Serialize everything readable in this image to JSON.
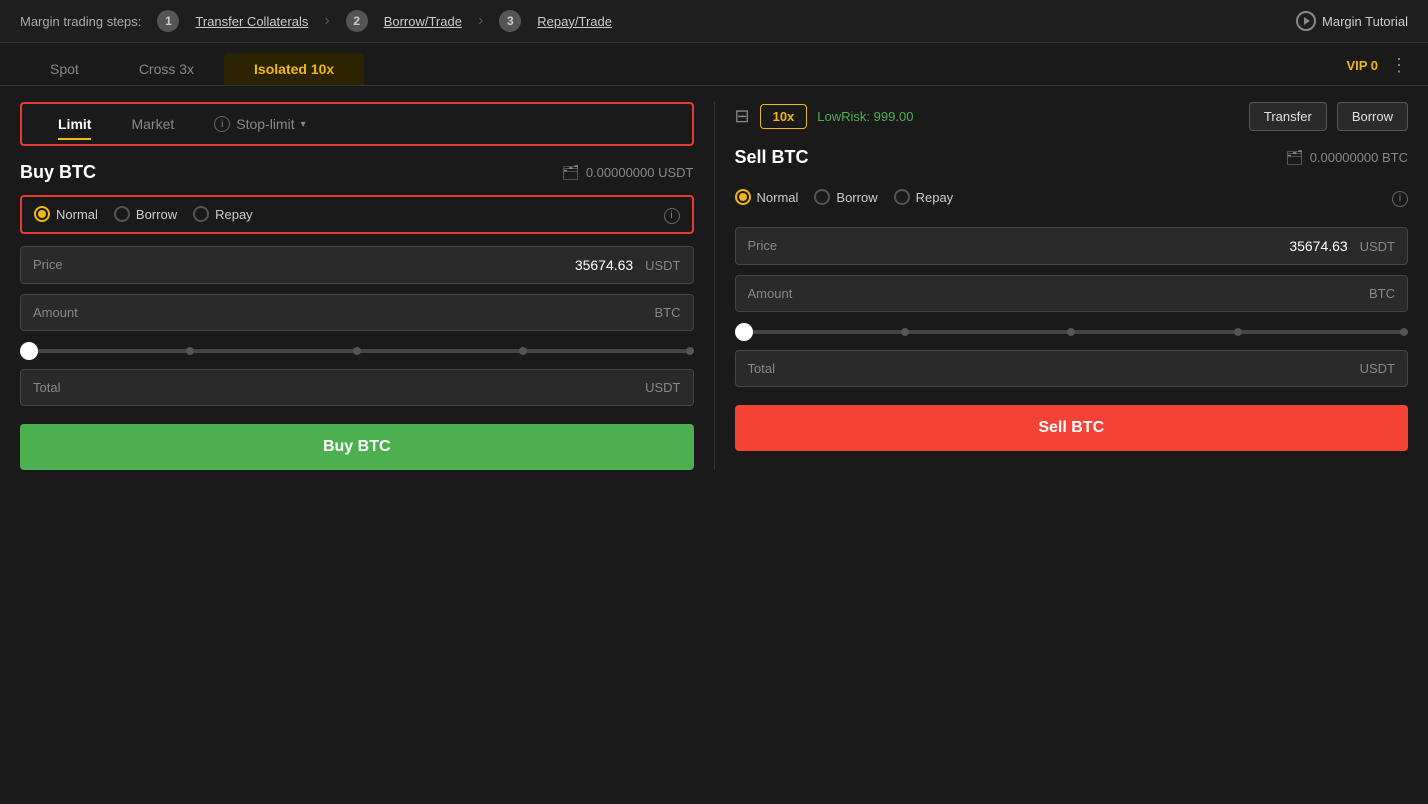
{
  "topnav": {
    "label": "Margin trading steps:",
    "step1_num": "1",
    "step1_label": "Transfer Collaterals",
    "step2_num": "2",
    "step2_label": "Borrow/Trade",
    "step3_num": "3",
    "step3_label": "Repay/Trade",
    "tutorial_label": "Margin Tutorial"
  },
  "tabs": {
    "spot_label": "Spot",
    "cross_label": "Cross 3x",
    "isolated_label": "Isolated",
    "isolated_leverage": "10x"
  },
  "vip": {
    "label": "VIP 0"
  },
  "ordertype": {
    "limit_label": "Limit",
    "market_label": "Market",
    "stoplimit_label": "Stop-limit"
  },
  "controls": {
    "leverage": "10x",
    "lowrisk_label": "LowRisk:",
    "lowrisk_value": "999.00",
    "transfer_label": "Transfer",
    "borrow_label": "Borrow"
  },
  "buy": {
    "title": "Buy BTC",
    "balance": "0.00000000 USDT",
    "radio_normal": "Normal",
    "radio_borrow": "Borrow",
    "radio_repay": "Repay",
    "price_label": "Price",
    "price_value": "35674.63",
    "price_unit": "USDT",
    "amount_label": "Amount",
    "amount_unit": "BTC",
    "total_label": "Total",
    "total_unit": "USDT",
    "btn_label": "Buy BTC"
  },
  "sell": {
    "title": "Sell BTC",
    "balance": "0.00000000 BTC",
    "radio_normal": "Normal",
    "radio_borrow": "Borrow",
    "radio_repay": "Repay",
    "price_label": "Price",
    "price_value": "35674.63",
    "price_unit": "USDT",
    "amount_label": "Amount",
    "amount_unit": "BTC",
    "total_label": "Total",
    "total_unit": "USDT",
    "btn_label": "Sell BTC"
  }
}
